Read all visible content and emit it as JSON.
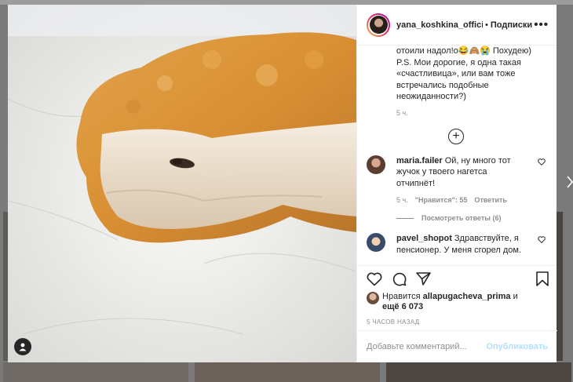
{
  "post": {
    "username": "yana_koshkina_official",
    "dot": "•",
    "follow_label": "Подписки",
    "more_label": "•••",
    "caption_text": "отоили надол!о😂🙈😭 Похудею) P.S. Мои дорогие, я одна такая «счастливица», или вам тоже встречались подобные неожиданности?)",
    "caption_time": "5 ч.",
    "comments": [
      {
        "username": "maria.failer",
        "text": "Ой, ну много тот жучок у твоего нагетса отчипнёт!",
        "time": "5 ч.",
        "likes": "\"Нравится\": 55",
        "reply": "Ответить",
        "view_replies": "Посмотреть ответы (6)"
      },
      {
        "username": "pavel_shopot",
        "text": "Здравствуйте, я пенсионер. У меня сгорел дом."
      }
    ],
    "likes_prefix": "Нравится",
    "liked_by": "allapugacheva_prima",
    "likes_and": "и",
    "likes_more": "ещё 6 073",
    "post_time": "5 ЧАСОВ НАЗАД",
    "comment_placeholder": "Добавьте комментарий...",
    "publish_label": "Опубликовать"
  },
  "icons": {
    "like": "heart-icon",
    "comment": "comment-icon",
    "share": "share-icon",
    "save": "bookmark-icon",
    "tag": "user-tag-icon",
    "load_more": "plus-circle-icon"
  },
  "colors": {
    "link_blue_disabled": "#b2dffc",
    "muted_text": "#8e8e8e"
  }
}
